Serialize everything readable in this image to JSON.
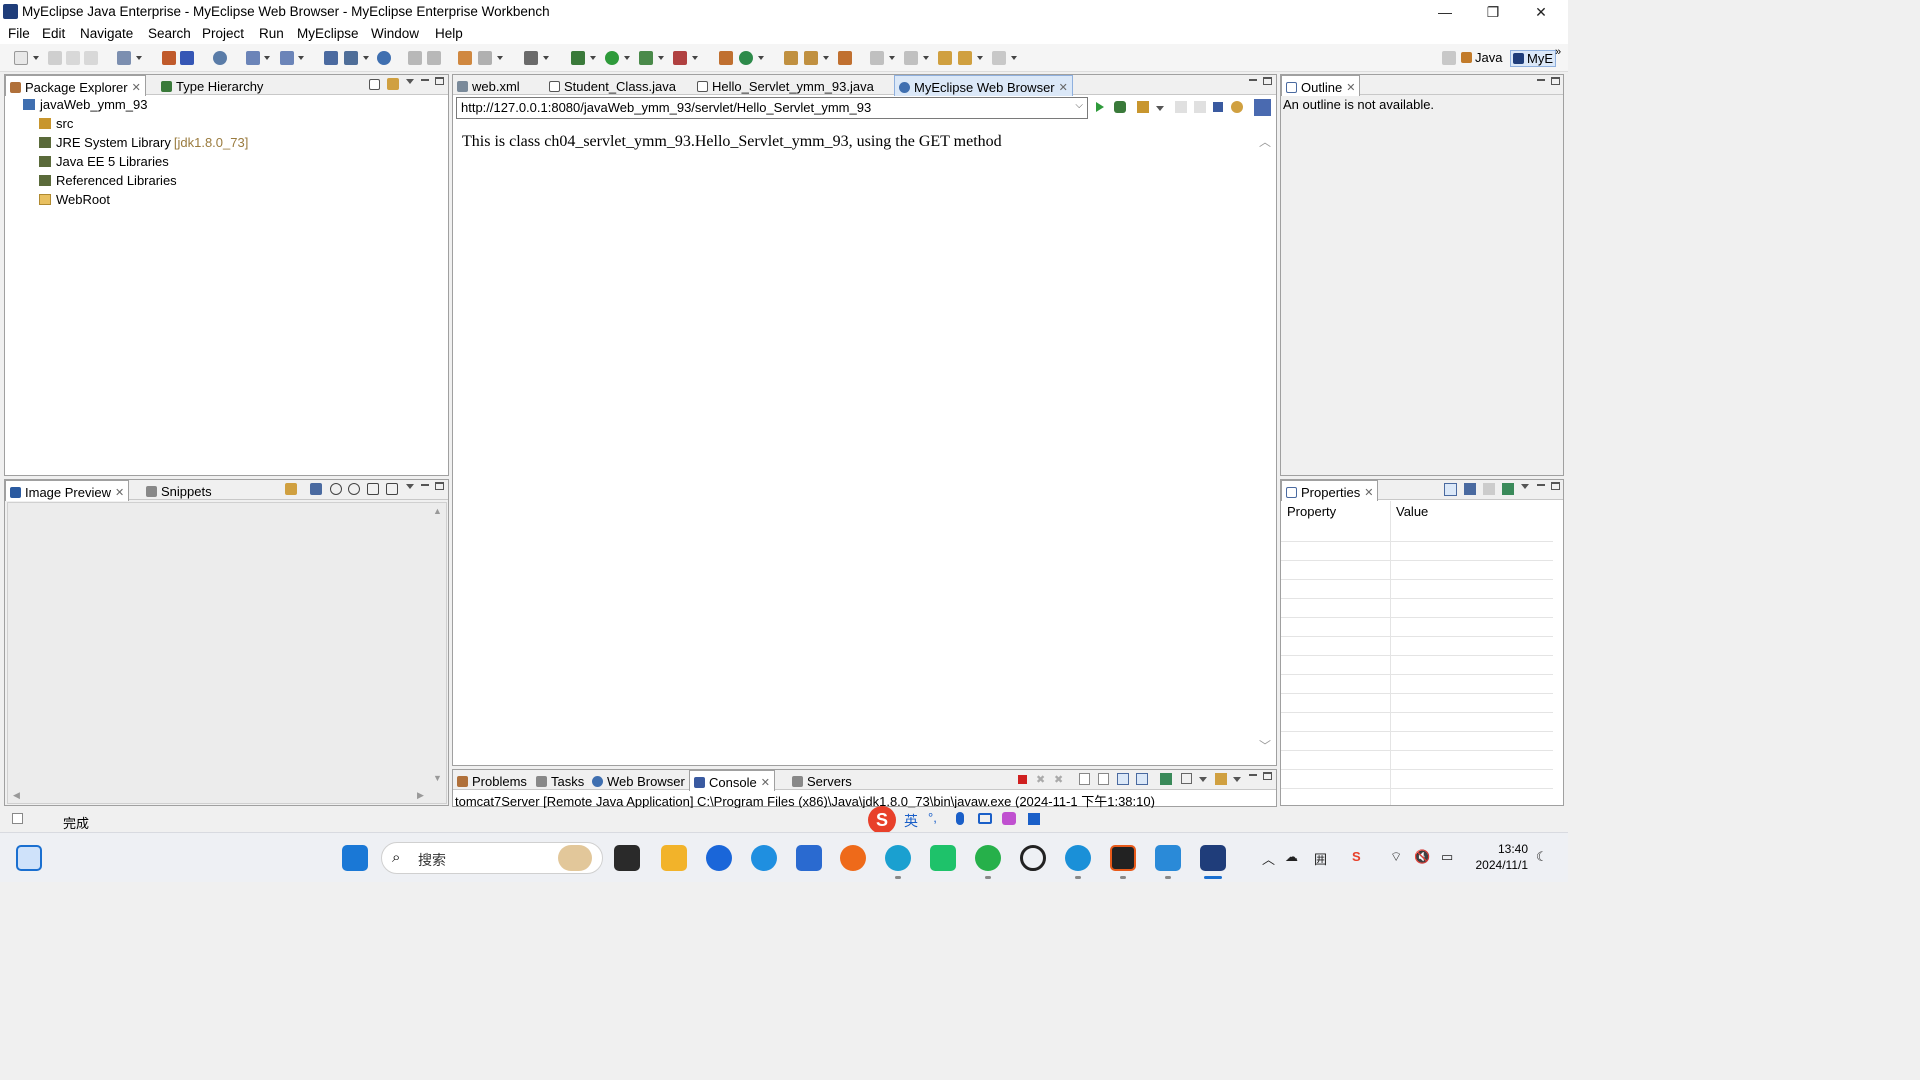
{
  "window": {
    "title": "MyEclipse Java Enterprise - MyEclipse Web Browser - MyEclipse Enterprise Workbench",
    "minimize": "—",
    "restore": "❐",
    "close": "✕"
  },
  "menu": [
    "File",
    "Edit",
    "Navigate",
    "Search",
    "Project",
    "Run",
    "MyEclipse",
    "Window",
    "Help"
  ],
  "perspectives": {
    "java": "Java",
    "myeclipse": "MyE",
    "more": "»"
  },
  "package_explorer": {
    "tabs": {
      "active": "Package Explorer",
      "other": "Type Hierarchy"
    },
    "project": "javaWeb_ymm_93",
    "items": [
      {
        "label": "src",
        "suffix": ""
      },
      {
        "label": "JRE System Library",
        "suffix": "[jdk1.8.0_73]"
      },
      {
        "label": "Java EE 5 Libraries",
        "suffix": ""
      },
      {
        "label": "Referenced Libraries",
        "suffix": ""
      },
      {
        "label": "WebRoot",
        "suffix": ""
      }
    ]
  },
  "editor": {
    "tabs": [
      "web.xml",
      "Student_Class.java",
      "Hello_Servlet_ymm_93.java",
      "MyEclipse Web Browser"
    ],
    "url": "http://127.0.0.1:8080/javaWeb_ymm_93/servlet/Hello_Servlet_ymm_93",
    "page_text": "This is class ch04_servlet_ymm_93.Hello_Servlet_ymm_93, using the GET method"
  },
  "outline": {
    "tab": "Outline",
    "message": "An outline is not available."
  },
  "image_preview": {
    "tabs": {
      "active": "Image Preview",
      "other": "Snippets"
    }
  },
  "properties": {
    "tab": "Properties",
    "col_property": "Property",
    "col_value": "Value"
  },
  "bottom_panel": {
    "tabs": [
      "Problems",
      "Tasks",
      "Web Browser",
      "Console",
      "Servers"
    ],
    "console_line": "tomcat7Server [Remote Java Application] C:\\Program Files (x86)\\Java\\jdk1.8.0_73\\bin\\javaw.exe (2024-11-1 下午1:38:10)"
  },
  "status": {
    "text": "完成"
  },
  "ime": {
    "lang": "英",
    "punct": "°,"
  },
  "taskbar": {
    "search_placeholder": "搜索",
    "tray_lang": "囲",
    "time": "13:40",
    "date": "2024/11/1"
  },
  "colors": {
    "accent": "#0078d7",
    "browser_tab": "#dbe8f8",
    "jre_suffix": "#9a7b3e",
    "taskbar": "#eef0f4"
  }
}
